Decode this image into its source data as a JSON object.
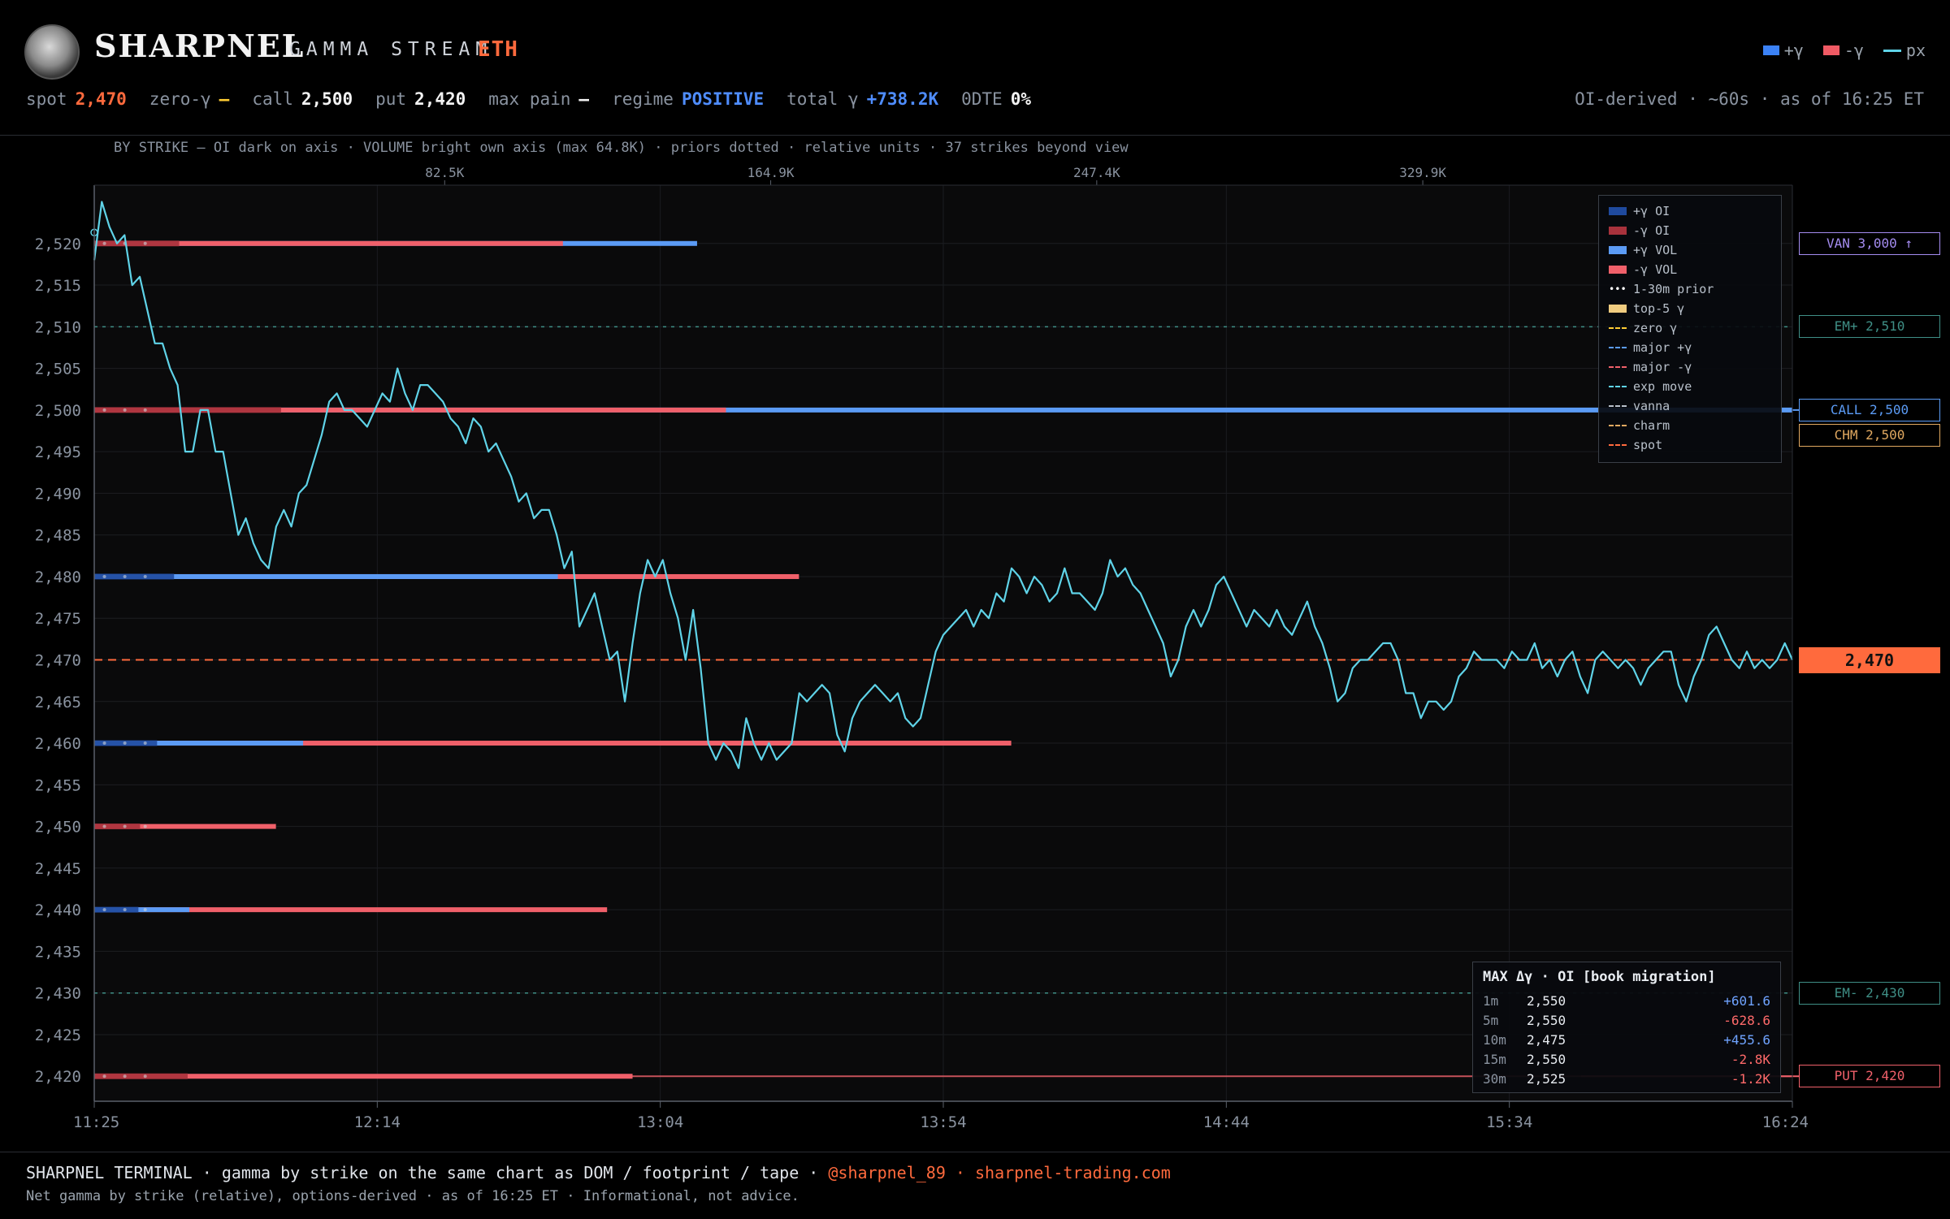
{
  "header": {
    "brand": "SHARPNEL",
    "subtitle": "GAMMA STREAM",
    "ticker": "ETH",
    "legend": [
      {
        "label": "+γ",
        "color": "#3b82f6",
        "kind": "box"
      },
      {
        "label": "-γ",
        "color": "#f05a64",
        "kind": "box"
      },
      {
        "label": "px",
        "color": "#5fd3e8",
        "kind": "line"
      }
    ],
    "stats": {
      "spot_label": "spot",
      "spot_value": "2,470",
      "zero_label": "zero-γ",
      "zero_value": "—",
      "call_label": "call",
      "call_value": "2,500",
      "put_label": "put",
      "put_value": "2,420",
      "maxpain_label": "max pain",
      "maxpain_value": "—",
      "regime_label": "regime",
      "regime_value": "POSITIVE",
      "total_label": "total γ",
      "total_value": "+738.2K",
      "dte_label": "0DTE",
      "dte_value": "0%"
    },
    "status_right": "OI-derived · ~60s · as of 16:25 ET"
  },
  "colors": {
    "pos_oi": "#1f4a9e",
    "neg_oi": "#a8323c",
    "pos_vol": "#5b9bf5",
    "neg_vol": "#f0606a",
    "price": "#5fd3e8",
    "spot": "#ff6a3d",
    "em": "#3f8f86"
  },
  "chart_data": {
    "type": "line",
    "caption": "BY STRIKE — OI dark on axis · VOLUME bright own axis (max 64.8K) · priors dotted · relative units · 37 strikes beyond view",
    "x_ticks": [
      "11:25",
      "12:14",
      "13:04",
      "13:54",
      "14:44",
      "15:34",
      "16:24"
    ],
    "vol_ticks": [
      "82.5K",
      "164.9K",
      "247.4K",
      "329.9K"
    ],
    "ylim": [
      2417,
      2527
    ],
    "y_ticks": [
      2520,
      2515,
      2510,
      2505,
      2500,
      2495,
      2490,
      2485,
      2480,
      2475,
      2470,
      2465,
      2460,
      2455,
      2450,
      2445,
      2440,
      2435,
      2430,
      2425,
      2420
    ],
    "y_tick_labels": [
      "2,520",
      "2,515",
      "2,510",
      "2,505",
      "2,500",
      "2,495",
      "2,490",
      "2,485",
      "2,480",
      "2,475",
      "2,470",
      "2,465",
      "2,460",
      "2,455",
      "2,450",
      "2,445",
      "2,440",
      "2,435",
      "2,430",
      "2,425",
      "2,420"
    ],
    "strike_bars": [
      {
        "strike": 2520,
        "pos_oi": 0.0,
        "neg_oi": 0.05,
        "pos_vol": 0.355,
        "neg_vol": 0.276
      },
      {
        "strike": 2500,
        "pos_oi": 0.0,
        "neg_oi": 0.11,
        "pos_vol": 1.0,
        "neg_vol": 0.372
      },
      {
        "strike": 2480,
        "pos_oi": 0.047,
        "neg_oi": 0.0,
        "pos_vol": 0.273,
        "neg_vol": 0.415
      },
      {
        "strike": 2460,
        "pos_oi": 0.037,
        "neg_oi": 0.0,
        "pos_vol": 0.123,
        "neg_vol": 0.54
      },
      {
        "strike": 2450,
        "pos_oi": 0.0,
        "neg_oi": 0.027,
        "pos_vol": 0.0,
        "neg_vol": 0.107
      },
      {
        "strike": 2440,
        "pos_oi": 0.026,
        "neg_oi": 0.0,
        "pos_vol": 0.056,
        "neg_vol": 0.302
      },
      {
        "strike": 2420,
        "pos_oi": 0.0,
        "neg_oi": 0.055,
        "pos_vol": 0.0,
        "neg_vol": 0.317,
        "neg_wall": 1.0
      }
    ],
    "levels": {
      "spot": 2470,
      "em_plus": 2510,
      "em_minus": 2430,
      "call": 2500,
      "put": 2420
    },
    "series": [
      {
        "name": "px",
        "values": [
          2518,
          2525,
          2522,
          2520,
          2521,
          2515,
          2516,
          2512,
          2508,
          2508,
          2505,
          2503,
          2495,
          2495,
          2500,
          2500,
          2495,
          2495,
          2490,
          2485,
          2487,
          2484,
          2482,
          2481,
          2486,
          2488,
          2486,
          2490,
          2491,
          2494,
          2497,
          2501,
          2502,
          2500,
          2500,
          2499,
          2498,
          2500,
          2502,
          2501,
          2505,
          2502,
          2500,
          2503,
          2503,
          2502,
          2501,
          2499,
          2498,
          2496,
          2499,
          2498,
          2495,
          2496,
          2494,
          2492,
          2489,
          2490,
          2487,
          2488,
          2488,
          2485,
          2481,
          2483,
          2474,
          2476,
          2478,
          2474,
          2470,
          2471,
          2465,
          2472,
          2478,
          2482,
          2480,
          2482,
          2478,
          2475,
          2470,
          2476,
          2469,
          2460,
          2458,
          2460,
          2459,
          2457,
          2463,
          2460,
          2458,
          2460,
          2458,
          2459,
          2460,
          2466,
          2465,
          2466,
          2467,
          2466,
          2461,
          2459,
          2463,
          2465,
          2466,
          2467,
          2466,
          2465,
          2466,
          2463,
          2462,
          2463,
          2467,
          2471,
          2473,
          2474,
          2475,
          2476,
          2474,
          2476,
          2475,
          2478,
          2477,
          2481,
          2480,
          2478,
          2480,
          2479,
          2477,
          2478,
          2481,
          2478,
          2478,
          2477,
          2476,
          2478,
          2482,
          2480,
          2481,
          2479,
          2478,
          2476,
          2474,
          2472,
          2468,
          2470,
          2474,
          2476,
          2474,
          2476,
          2479,
          2480,
          2478,
          2476,
          2474,
          2476,
          2475,
          2474,
          2476,
          2474,
          2473,
          2475,
          2477,
          2474,
          2472,
          2469,
          2465,
          2466,
          2469,
          2470,
          2470,
          2471,
          2472,
          2472,
          2470,
          2466,
          2466,
          2463,
          2465,
          2465,
          2464,
          2465,
          2468,
          2469,
          2471,
          2470,
          2470,
          2470,
          2469,
          2471,
          2470,
          2470,
          2472,
          2469,
          2470,
          2468,
          2470,
          2471,
          2468,
          2466,
          2470,
          2471,
          2470,
          2469,
          2470,
          2469,
          2467,
          2469,
          2470,
          2471,
          2471,
          2467,
          2465,
          2468,
          2470,
          2473,
          2474,
          2472,
          2470,
          2469,
          2471,
          2469,
          2470,
          2469,
          2470,
          2472,
          2470
        ]
      }
    ]
  },
  "right_tags": [
    {
      "label": "VAN 3,000 ↑",
      "strike": 2520,
      "color": "#a48cf0"
    },
    {
      "label": "EM+ 2,510",
      "strike": 2510,
      "color": "#3f8f86"
    },
    {
      "label": "CALL 2,500",
      "strike": 2500,
      "color": "#5b9bf5"
    },
    {
      "label": "CHM 2,500",
      "strike": 2497,
      "color": "#e0a860"
    },
    {
      "label": "EM- 2,430",
      "strike": 2430,
      "color": "#3f8f86"
    },
    {
      "label": "PUT 2,420",
      "strike": 2420,
      "color": "#f0606a"
    }
  ],
  "spot_tag": "2,470",
  "overlay_legend": [
    {
      "label": "+γ OI",
      "color": "#1f4a9e",
      "kind": "box"
    },
    {
      "label": "-γ OI",
      "color": "#a8323c",
      "kind": "box"
    },
    {
      "label": "+γ VOL",
      "color": "#5b9bf5",
      "kind": "box"
    },
    {
      "label": "-γ VOL",
      "color": "#f0606a",
      "kind": "box"
    },
    {
      "label": "1-30m prior",
      "color": "#ffffff",
      "kind": "dots"
    },
    {
      "label": "top-5 γ",
      "color": "#f0cc80",
      "kind": "box"
    },
    {
      "label": "zero γ",
      "color": "#ffcc33",
      "kind": "dash"
    },
    {
      "label": "major +γ",
      "color": "#5b9bf5",
      "kind": "dash"
    },
    {
      "label": "major -γ",
      "color": "#f0606a",
      "kind": "dash"
    },
    {
      "label": "exp move",
      "color": "#5fd3e8",
      "kind": "dash"
    },
    {
      "label": "vanna",
      "color": "#b8c0ca",
      "kind": "dash"
    },
    {
      "label": "charm",
      "color": "#e0a860",
      "kind": "dash"
    },
    {
      "label": "spot",
      "color": "#ff6a3d",
      "kind": "dash"
    }
  ],
  "migration": {
    "title": "MAX Δγ · OI [book migration]",
    "rows": [
      {
        "window": "1m",
        "strike": "2,550",
        "delta": "+601.6",
        "sign": "pos"
      },
      {
        "window": "5m",
        "strike": "2,550",
        "delta": "-628.6",
        "sign": "neg"
      },
      {
        "window": "10m",
        "strike": "2,475",
        "delta": "+455.6",
        "sign": "pos"
      },
      {
        "window": "15m",
        "strike": "2,550",
        "delta": "-2.8K",
        "sign": "neg"
      },
      {
        "window": "30m",
        "strike": "2,525",
        "delta": "-1.2K",
        "sign": "neg"
      }
    ]
  },
  "footer": {
    "line1_main": "SHARPNEL TERMINAL · gamma by strike on the same chart as DOM / footprint / tape · ",
    "line1_accent": "@sharpnel_89 · sharpnel-trading.com",
    "line2": "Net gamma by strike (relative), options-derived · as of 16:25 ET · Informational, not advice."
  }
}
